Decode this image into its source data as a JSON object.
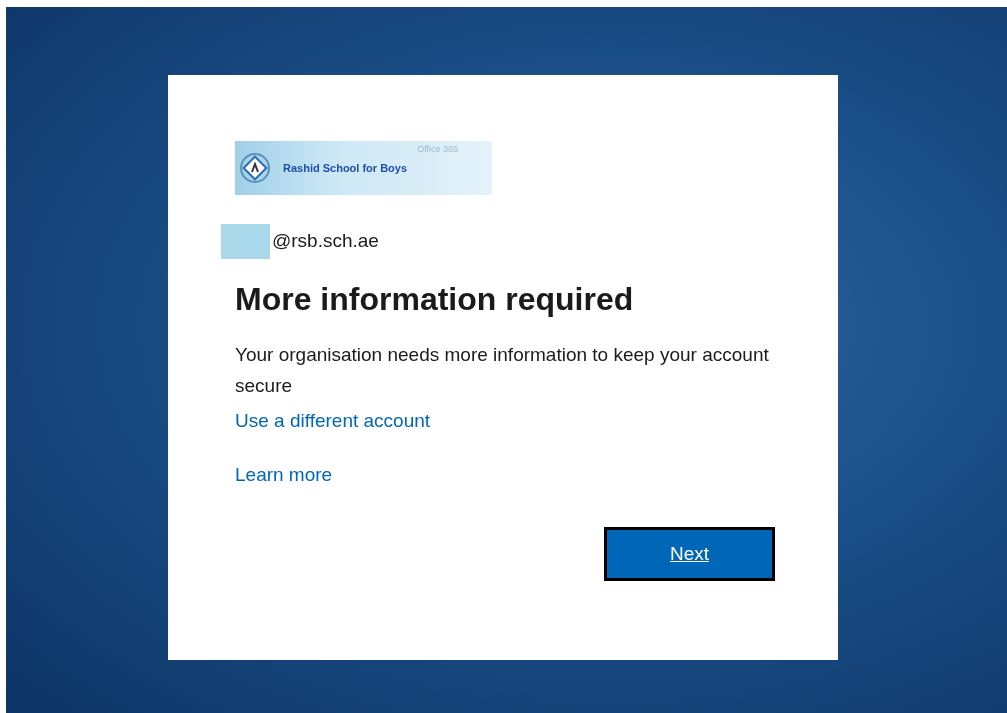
{
  "logo": {
    "name": "Rashid School for Boys",
    "product": "Office 365"
  },
  "account": {
    "email": "@rsb.sch.ae"
  },
  "title": "More information required",
  "description": "Your organisation needs more information to keep your account secure",
  "links": [
    "Use a different account",
    "Learn more"
  ],
  "buttons": [
    "Next"
  ]
}
